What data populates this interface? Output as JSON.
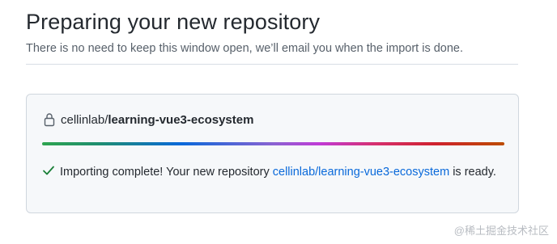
{
  "header": {
    "title": "Preparing your new repository",
    "subtitle": "There is no need to keep this window open, we’ll email you when the import is done."
  },
  "repo": {
    "owner": "cellinlab",
    "separator": "/",
    "name": "learning-vue3-ecosystem"
  },
  "progress": {
    "fraction": 1.0
  },
  "status": {
    "prefix": "Importing complete! Your new repository ",
    "link_text": "cellinlab/learning-vue3-ecosystem",
    "suffix": " is ready."
  },
  "watermark": "@稀土掘金技术社区",
  "colors": {
    "success": "#1a7f37",
    "link": "#0969da"
  }
}
